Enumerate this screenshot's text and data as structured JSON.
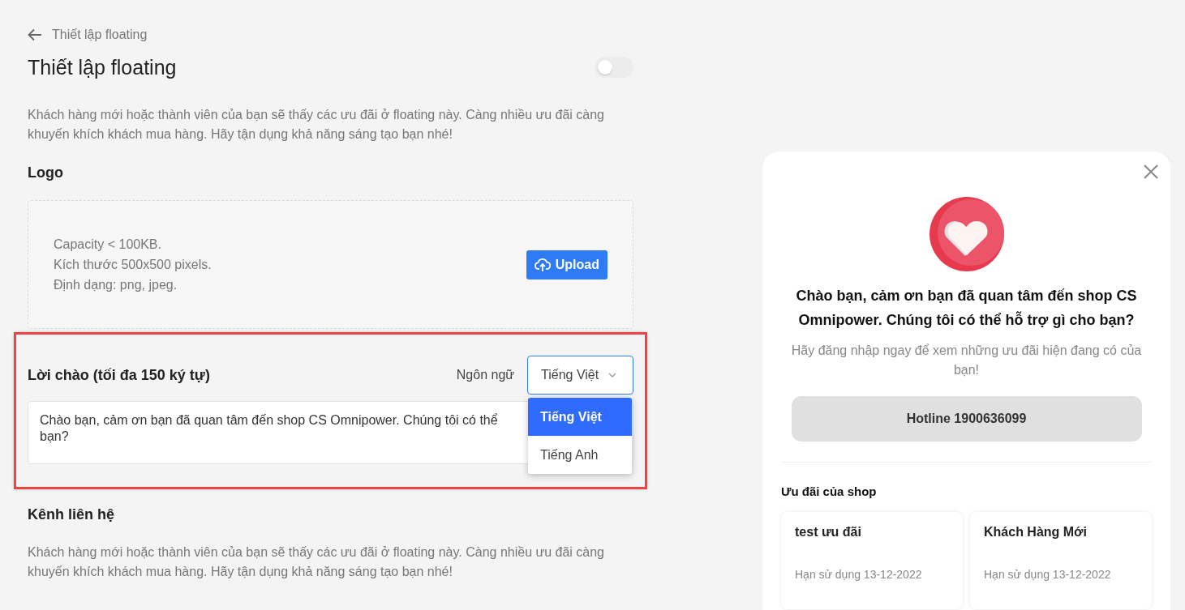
{
  "breadcrumb": {
    "label": "Thiết lập floating"
  },
  "header": {
    "title": "Thiết lập floating",
    "enabled": false
  },
  "intro": "Khách hàng mới hoặc thành viên của bạn sẽ thấy các ưu đãi ở floating này. Càng nhiều ưu đãi càng khuyến khích khách mua hàng. Hãy tận dụng khả năng sáng tạo bạn nhé!",
  "logo": {
    "title": "Logo",
    "requirements": [
      "Capacity < 100KB.",
      "Kích thước 500x500 pixels.",
      "Định dạng: png, jpeg."
    ],
    "upload_button": "Upload"
  },
  "greeting": {
    "title": "Lời chào (tối đa 150 ký tự)",
    "highlighted": true,
    "language_label": "Ngôn ngữ",
    "language_value": "Tiếng Việt",
    "language_options": [
      {
        "label": "Tiếng Việt",
        "selected": true
      },
      {
        "label": "Tiếng Anh",
        "selected": false
      }
    ],
    "message_lines": [
      "Chào bạn, cảm ơn bạn đã quan tâm đến shop CS Omnipower. Chúng tôi có thể",
      "bạn?"
    ]
  },
  "contact": {
    "title": "Kênh liên hệ",
    "description": "Khách hàng mới hoặc thành viên của bạn sẽ thấy các ưu đãi ở floating này. Càng nhiều ưu đãi càng khuyến khích khách mua hàng. Hãy tận dụng khả năng sáng tạo bạn nhé!"
  },
  "preview": {
    "heading": "Chào bạn, cảm ơn bạn đã quan tâm đến shop CS Omnipower. Chúng tôi có thể hỗ trợ gì cho bạn?",
    "subtext": "Hãy đăng nhập ngay để xem những ưu đãi hiện đang có của bạn!",
    "hotline_button": "Hotline 1900636099",
    "offers_title": "Ưu đãi của shop",
    "offers": [
      {
        "title": "test ưu đãi",
        "expiry": "Hạn sử dụng 13-12-2022"
      },
      {
        "title": "Khách Hàng Mới",
        "expiry": "Hạn sử dụng 13-12-2022"
      }
    ]
  }
}
